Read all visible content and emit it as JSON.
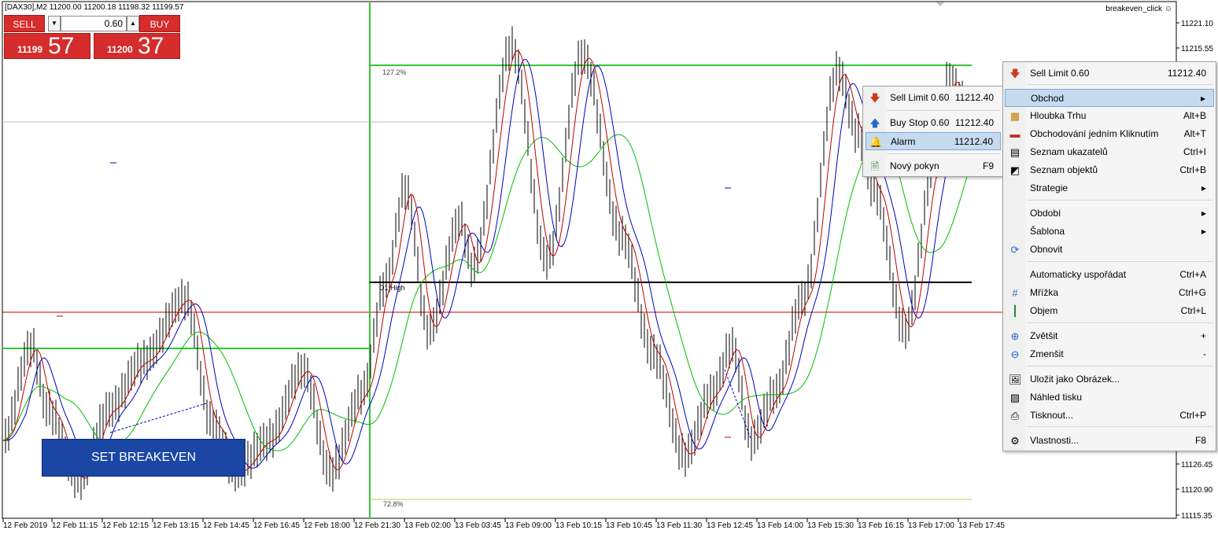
{
  "header": {
    "title": "[DAX30],M2  11200.00 11200.18 11198.32 11199.57",
    "expert_label": "breakeven_click"
  },
  "trade_panel": {
    "sell_label": "SELL",
    "buy_label": "BUY",
    "lot_value": "0.60",
    "sell_price_small": "11199",
    "sell_price_big": "57",
    "buy_price_small": "11200",
    "buy_price_big": "37"
  },
  "breakeven_button": "SET BREAKEVEN",
  "chart": {
    "fib_top_label": "127.2%",
    "fib_bottom_label": "72.8%",
    "d1_label": "D1 High",
    "y_ticks": [
      "11221.10",
      "11215.55",
      "11126.45",
      "11120.90",
      "11115.35"
    ],
    "x_ticks": [
      "12 Feb 2019",
      "12 Feb 11:15",
      "12 Feb 12:15",
      "12 Feb 13:15",
      "12 Feb 14:45",
      "12 Feb 16:45",
      "12 Feb 18:00",
      "12 Feb 21:30",
      "13 Feb 02:00",
      "13 Feb 03:45",
      "13 Feb 09:00",
      "13 Feb 10:15",
      "13 Feb 10:45",
      "13 Feb 11:30",
      "13 Feb 12:45",
      "13 Feb 14:00",
      "13 Feb 15:30",
      "13 Feb 16:15",
      "13 Feb 17:00",
      "13 Feb 17:45"
    ],
    "colors": {
      "fast_ma": "#c00000",
      "slow_ma": "#0000c0",
      "long_ma": "#00c000",
      "fib": "#32c832",
      "d1": "#000000",
      "price_line": "#c00000"
    }
  },
  "submenu": {
    "items": [
      {
        "label": "Sell Limit 0.60",
        "shortcut": "11212.40",
        "icon": "sell-limit-icon"
      },
      {
        "label": "Buy Stop 0.60",
        "shortcut": "11212.40",
        "icon": "buy-stop-icon"
      },
      {
        "label": "Alarm",
        "shortcut": "11212.40",
        "icon": "alarm-bell-icon"
      },
      {
        "label": "Nový pokyn",
        "shortcut": "F9",
        "icon": "new-order-icon"
      }
    ]
  },
  "context_menu": {
    "items": [
      {
        "label": "Sell Limit 0.60",
        "shortcut": "11212.40"
      },
      {
        "label": "Obchod",
        "shortcut": "▸"
      },
      {
        "label": "Hloubka Trhu",
        "shortcut": "Alt+B"
      },
      {
        "label": "Obchodování jedním Kliknutím",
        "shortcut": "Alt+T"
      },
      {
        "label": "Seznam ukazatelů",
        "shortcut": "Ctrl+I"
      },
      {
        "label": "Seznam objektů",
        "shortcut": "Ctrl+B"
      },
      {
        "label": "Strategie",
        "shortcut": "▸"
      },
      {
        "label": "Období",
        "shortcut": "▸"
      },
      {
        "label": "Šablona",
        "shortcut": "▸"
      },
      {
        "label": "Obnovit",
        "shortcut": ""
      },
      {
        "label": "Automaticky uspořádat",
        "shortcut": "Ctrl+A"
      },
      {
        "label": "Mřížka",
        "shortcut": "Ctrl+G"
      },
      {
        "label": "Objem",
        "shortcut": "Ctrl+L"
      },
      {
        "label": "Zvětšit",
        "shortcut": "+"
      },
      {
        "label": "Zmenšit",
        "shortcut": "-"
      },
      {
        "label": "Uložit jako Obrázek...",
        "shortcut": ""
      },
      {
        "label": "Náhled tisku",
        "shortcut": ""
      },
      {
        "label": "Tisknout...",
        "shortcut": "Ctrl+P"
      },
      {
        "label": "Vlastnosti...",
        "shortcut": "F8"
      }
    ]
  }
}
